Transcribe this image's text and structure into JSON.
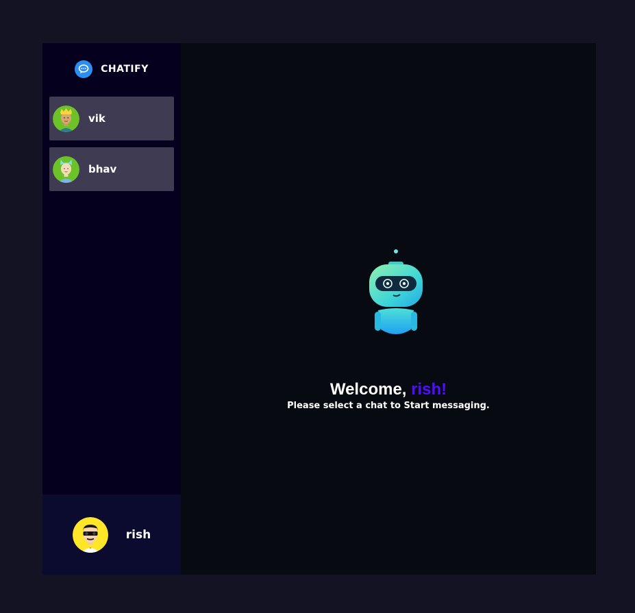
{
  "brand": {
    "name": "CHATIFY",
    "icon": "chat-bubble-icon"
  },
  "contacts": [
    {
      "name": "vik",
      "avatar": "avatar-crowned-man"
    },
    {
      "name": "bhav",
      "avatar": "avatar-cat-ears-man"
    }
  ],
  "current_user": {
    "name": "rish",
    "avatar": "avatar-sunglasses-man"
  },
  "welcome": {
    "prefix": "Welcome, ",
    "username": "rish!",
    "subtitle": "Please select a chat to Start messaging."
  },
  "colors": {
    "page_bg": "#131324",
    "sidebar_bg": "#06001f",
    "contact_bg": "#3e3b52",
    "user_panel_bg": "#0b0b30",
    "main_bg": "#080a11",
    "accent": "#4e0eff"
  }
}
